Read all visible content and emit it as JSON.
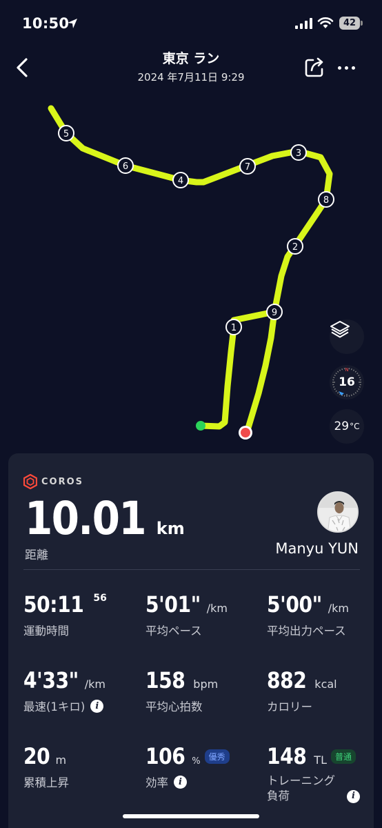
{
  "status_bar": {
    "time": "10:50",
    "battery": "42"
  },
  "header": {
    "title": "東京 ラン",
    "datetime": "2024 年7月11日 9:29"
  },
  "map": {
    "route_color": "#d8f51a",
    "markers": [
      "1",
      "2",
      "3",
      "4",
      "5",
      "6",
      "7",
      "8",
      "9"
    ],
    "compass_value": "16",
    "compass_label": "N",
    "temperature": "29",
    "temperature_unit": "°C"
  },
  "card": {
    "brand": "COROS",
    "distance_value": "10.01",
    "distance_unit": "km",
    "distance_label": "距離",
    "user_name": "Manyu YUN",
    "stats": {
      "time_value": "50:11",
      "time_sup": "56",
      "time_label": "運動時間",
      "pace_value": "5'01\"",
      "pace_unit": "/km",
      "pace_label": "平均ペース",
      "power_pace_value": "5'00\"",
      "power_pace_unit": "/km",
      "power_pace_label": "平均出力ペース",
      "fastest_value": "4'33\"",
      "fastest_unit": "/km",
      "fastest_label": "最速(1キロ)",
      "hr_value": "158",
      "hr_unit": "bpm",
      "hr_label": "平均心拍数",
      "cal_value": "882",
      "cal_unit": "kcal",
      "cal_label": "カロリー",
      "elev_value": "20",
      "elev_unit": "m",
      "elev_label": "累積上昇",
      "eff_value": "106",
      "eff_unit": "%",
      "eff_badge": "優秀",
      "eff_label": "効率",
      "load_value": "148",
      "load_unit": "TL",
      "load_badge": "普通",
      "load_label_1": "トレーニング",
      "load_label_2": "負荷"
    }
  }
}
